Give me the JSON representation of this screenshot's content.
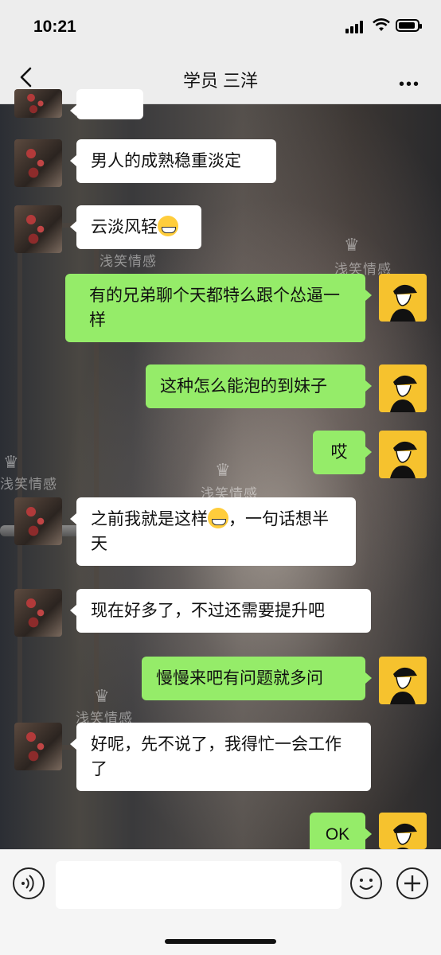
{
  "status": {
    "time": "10:21"
  },
  "header": {
    "title": "学员  三洋",
    "more_label": "•••"
  },
  "messages": [
    {
      "side": "left",
      "text": "男人的成熟稳重淡定"
    },
    {
      "side": "left",
      "text": "云淡风轻"
    },
    {
      "side": "right",
      "text": "有的兄弟聊个天都特么跟个怂逼一样"
    },
    {
      "side": "right",
      "text": "这种怎么能泡的到妹子"
    },
    {
      "side": "right",
      "text": "哎"
    },
    {
      "side": "left",
      "text": "之前我就是这样",
      "text2": "，一句话想半天"
    },
    {
      "side": "left",
      "text": "现在好多了，不过还需要提升吧"
    },
    {
      "side": "right",
      "text": "慢慢来吧有问题就多问"
    },
    {
      "side": "left",
      "text": "好呢，先不说了，我得忙一会工作了"
    },
    {
      "side": "right",
      "text": "OK"
    }
  ],
  "watermark": {
    "text": "浅笑情感"
  },
  "input": {
    "placeholder": ""
  },
  "colors": {
    "self_bubble": "#95ec69",
    "other_bubble": "#ffffff",
    "bar_bg": "#ededed"
  }
}
